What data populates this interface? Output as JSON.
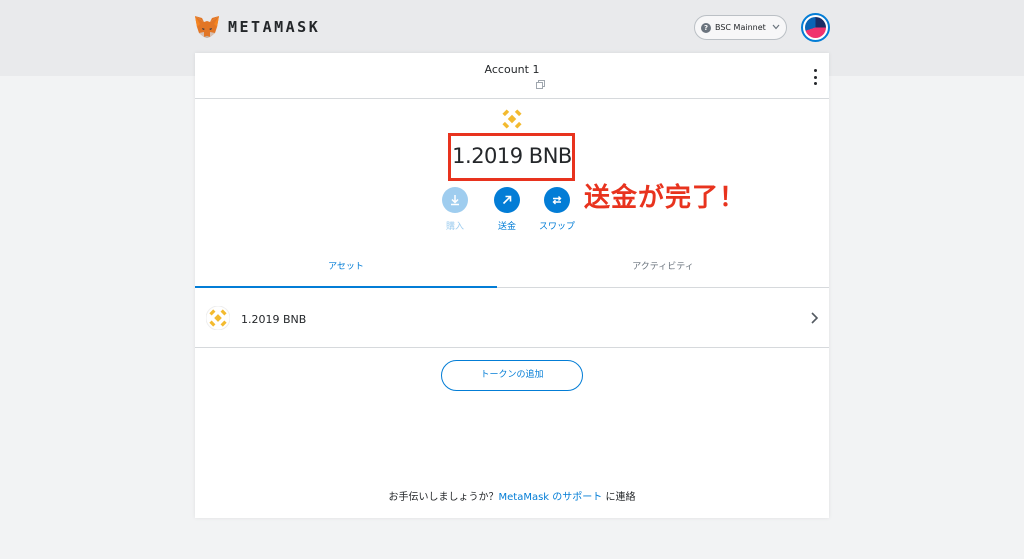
{
  "app": {
    "brand": "METAMASK"
  },
  "network": {
    "label": "BSC Mainnet",
    "help_glyph": "?"
  },
  "account": {
    "name": "Account 1"
  },
  "balance": {
    "amount": "1.2019 BNB"
  },
  "annotation": {
    "text": "送金が完了！",
    "color": "#e8331e"
  },
  "actions": [
    {
      "label": "購入",
      "icon": "download-icon",
      "enabled": false
    },
    {
      "label": "送金",
      "icon": "send-arrow-icon",
      "enabled": true
    },
    {
      "label": "スワップ",
      "icon": "swap-icon",
      "enabled": true
    }
  ],
  "tabs": [
    {
      "label": "アセット",
      "active": true
    },
    {
      "label": "アクティビティ",
      "active": false
    }
  ],
  "assets": [
    {
      "amount": "1.2019 BNB",
      "icon": "bnb-logo-icon"
    }
  ],
  "add_token": {
    "label": "トークンの追加"
  },
  "help": {
    "prefix": "お手伝いしましょうか？",
    "link": "MetaMask のサポート",
    "suffix": " に連絡"
  },
  "colors": {
    "accent": "#037dd6",
    "bnb": "#f3ba2f",
    "annotation": "#e8331e"
  }
}
